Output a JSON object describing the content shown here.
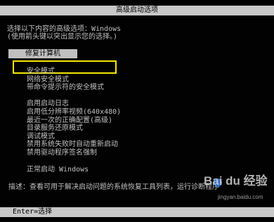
{
  "header": {
    "title": "高级启动选项"
  },
  "instructions": [
    "选择以下内容的高级选项：Windows",
    "(使用箭头键以突出显示您的选择。)"
  ],
  "repair": {
    "label": "修复计算机"
  },
  "menu_items": [
    "安全模式",
    "网络安全模式",
    "带命令提示符的安全模式",
    "启用启动日志",
    "启用低分辨率视频(640x480)",
    "最近一次的正确配置(高级)",
    "目录服务还原模式",
    "调试模式",
    "禁用系统失败时自动重新启动",
    "禁用驱动程序签名强制",
    "正常启动 Windows"
  ],
  "description": "描述：查看可用于解决启动问题的系统恢复工具列表，运行诊断程序",
  "footer": {
    "key_hint": "Enter=选择"
  },
  "watermark": {
    "logo": "Bai du 经验",
    "sub": "jingyan.baidu.com"
  },
  "colors": {
    "background": "#020202",
    "bar": "#c8c8c8",
    "text": "#c0c0c0",
    "highlight_box": "#f2e600"
  }
}
